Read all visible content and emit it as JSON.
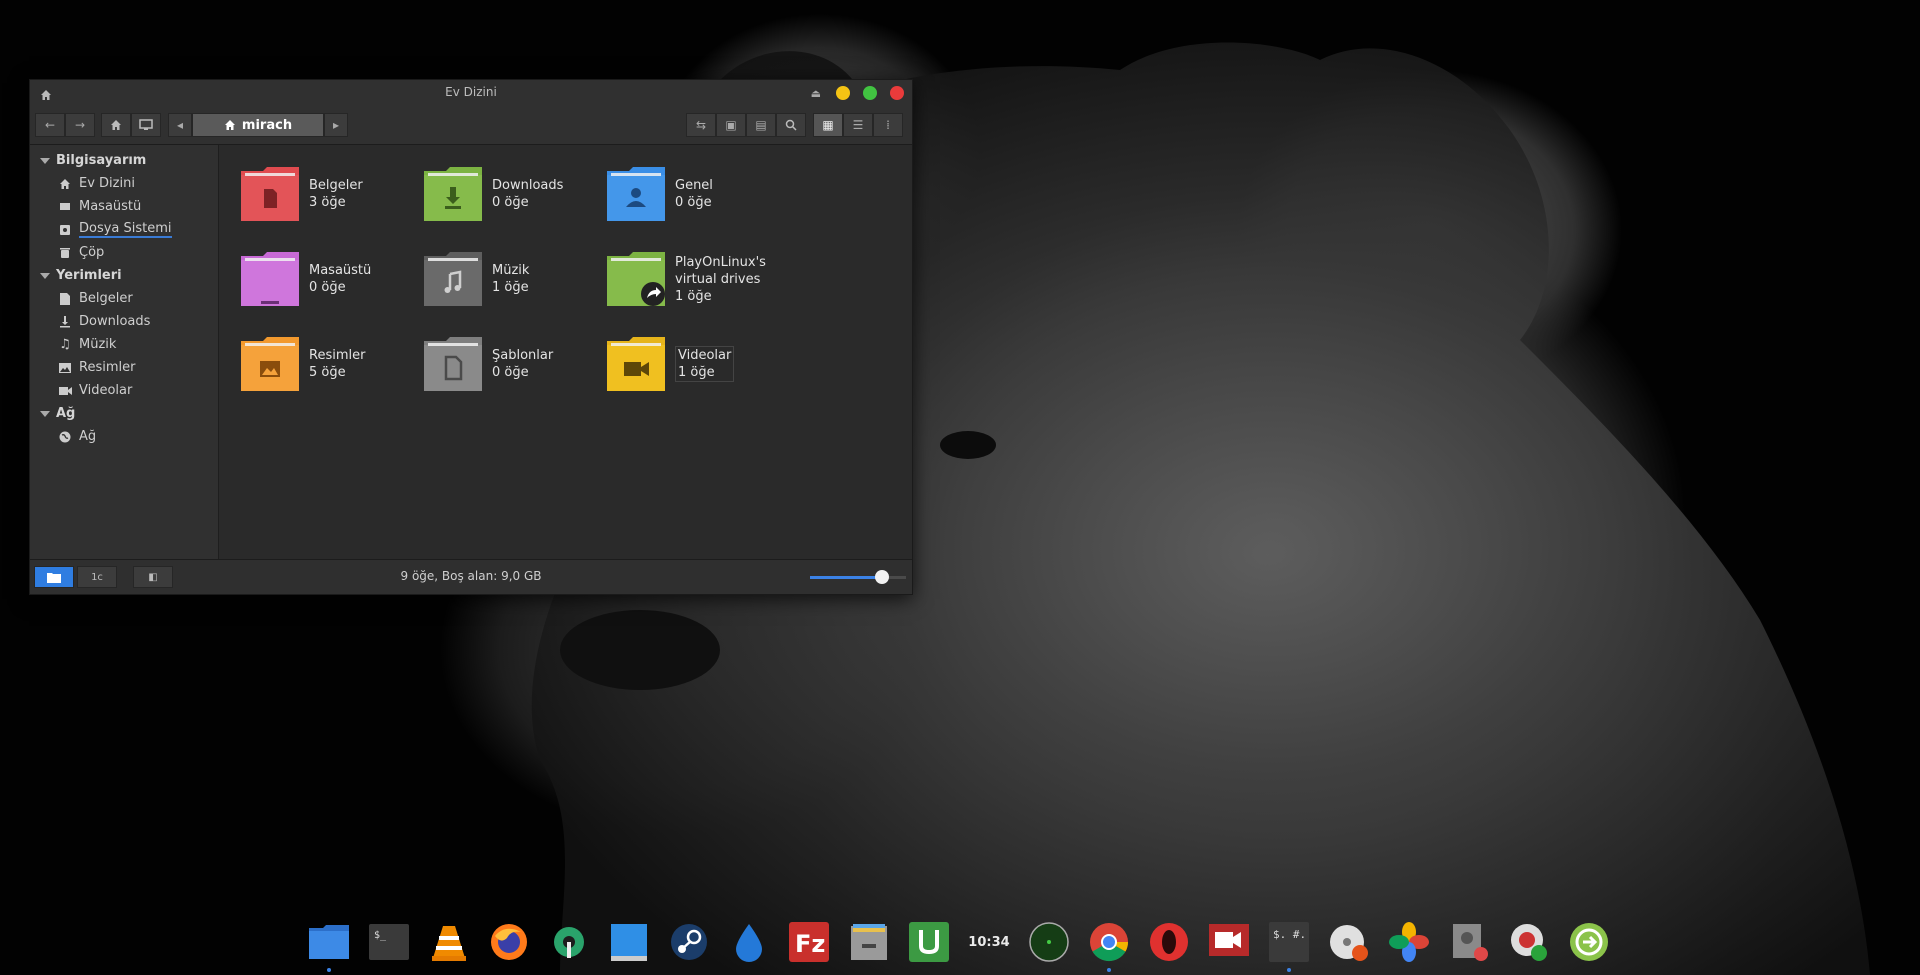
{
  "window": {
    "title": "Ev Dizini",
    "path_label": "mirach",
    "controls": {
      "minimize_color": "#f5c414",
      "maximize_color": "#41c341",
      "close_color": "#ea3b3b"
    }
  },
  "sidebar": {
    "sections": [
      {
        "label": "Bilgisayarım",
        "items": [
          {
            "label": "Ev Dizini",
            "icon": "home-icon"
          },
          {
            "label": "Masaüstü",
            "icon": "desktop-icon"
          },
          {
            "label": "Dosya Sistemi",
            "icon": "drive-icon"
          },
          {
            "label": "Çöp",
            "icon": "trash-icon"
          }
        ]
      },
      {
        "label": "Yerimleri",
        "items": [
          {
            "label": "Belgeler",
            "icon": "document-icon"
          },
          {
            "label": "Downloads",
            "icon": "download-icon"
          },
          {
            "label": "Müzik",
            "icon": "music-icon"
          },
          {
            "label": "Resimler",
            "icon": "image-icon"
          },
          {
            "label": "Videolar",
            "icon": "video-icon"
          }
        ]
      },
      {
        "label": "Ağ",
        "items": [
          {
            "label": "Ağ",
            "icon": "globe-icon"
          }
        ]
      }
    ]
  },
  "files": [
    {
      "name": "Belgeler",
      "count": "3 öğe",
      "color": "#e04b4f",
      "icon": "document-icon"
    },
    {
      "name": "Downloads",
      "count": "0 öğe",
      "color": "#7cb342",
      "icon": "download-icon"
    },
    {
      "name": "Genel",
      "count": "0 öğe",
      "color": "#3a8ee6",
      "icon": "user-icon"
    },
    {
      "name": "Masaüstü",
      "count": "0 öğe",
      "color": "#c86ad6",
      "icon": "desktop-icon"
    },
    {
      "name": "Müzik",
      "count": "1 öğe",
      "color": "#6e6e6e",
      "icon": "music-icon"
    },
    {
      "name": "PlayOnLinux's virtual drives",
      "count": "1 öğe",
      "color": "#7cb342",
      "icon": "symlink-icon"
    },
    {
      "name": "Resimler",
      "count": "5 öğe",
      "color": "#f2992e",
      "icon": "image-icon"
    },
    {
      "name": "Şablonlar",
      "count": "0 öğe",
      "color": "#8a8a8a",
      "icon": "template-icon"
    },
    {
      "name": "Videolar",
      "count": "1 öğe",
      "color": "#f0c020",
      "icon": "video-icon"
    }
  ],
  "statusbar": {
    "text": "9 öğe, Boş alan: 9,0 GB",
    "zoom_level": 0.75
  },
  "dock": {
    "clock": "10:34",
    "apps": [
      "files-icon",
      "terminal-icon",
      "vlc-icon",
      "firefox-icon",
      "settings-icon",
      "desktop-app-icon",
      "steam-icon",
      "drop-icon",
      "filezilla-icon",
      "archive-icon",
      "upwork-icon",
      "clock-icon",
      "radar-icon",
      "chrome-icon",
      "opera-icon",
      "screen-recorder-icon",
      "terminal-hash-icon",
      "disc-burner-icon",
      "photos-icon",
      "disk-settings-icon",
      "system-info-icon",
      "exit-icon"
    ]
  }
}
